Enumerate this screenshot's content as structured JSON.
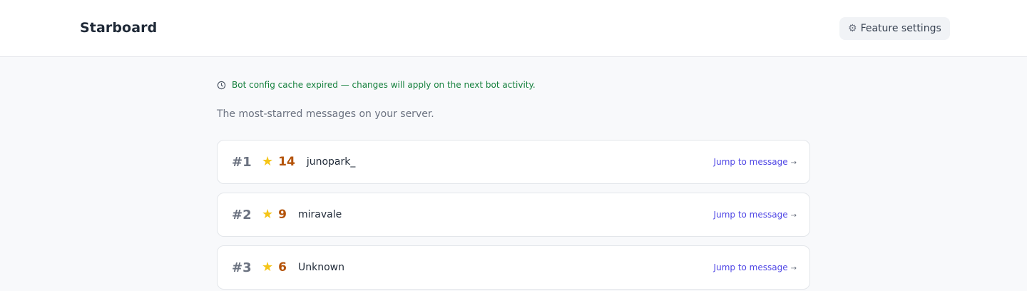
{
  "header": {
    "title": "Starboard",
    "settings_label": "Feature settings",
    "settings_icon": "gear-icon"
  },
  "notice": {
    "text": "Bot config cache expired — changes will apply on the next bot activity.",
    "icon": "clock-icon",
    "color": "#15803d"
  },
  "subtitle": "The most-starred messages on your server.",
  "entries": [
    {
      "rank": "#1",
      "stars": "14",
      "author": "junopark_",
      "link_label": "Jump to message",
      "link_arrow": "→"
    },
    {
      "rank": "#2",
      "stars": "9",
      "author": "miravale",
      "link_label": "Jump to message",
      "link_arrow": "→"
    },
    {
      "rank": "#3",
      "stars": "6",
      "author": "Unknown",
      "link_label": "Jump to message",
      "link_arrow": "→"
    }
  ],
  "colors": {
    "star_count": "#b45309",
    "link": "#4f46e5",
    "rank": "#6b7280"
  }
}
